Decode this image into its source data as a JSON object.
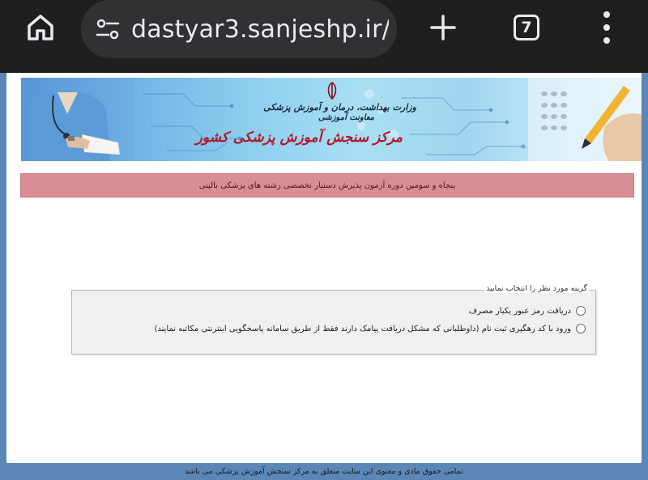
{
  "browser": {
    "url": "dastyar3.sanjeshp.ir/",
    "tab_count": "7",
    "icons": {
      "home": "home-icon",
      "site_settings": "tune-icon",
      "new_tab": "plus-icon",
      "tabs": "tab-switcher-icon",
      "menu": "more-vert-icon"
    }
  },
  "banner": {
    "line1": "وزارت بهداشت، درمان و آموزش پزشکی",
    "line2": "معاونت آموزشی",
    "line3": "مرکز سنجش آموزش پزشکی کشور"
  },
  "page": {
    "title": "پنجاه و سومین دوره آزمون پذیرش دستیار تخصصی رشته های پزشکی بالینی",
    "options_legend": "گزینه مورد نظر را انتخاب نمایید",
    "options": [
      {
        "label": "دریافت رمز عبور یکبار مصرف",
        "selected": false
      },
      {
        "label": "ورود با کد رهگیری ثبت نام (داوطلبانی که مشکل دریافت پیامک دارند فقط از طریق سامانه پاسخگویی اینترنتی مکاتبه نمایند)",
        "selected": false
      }
    ],
    "footer": "تمامی حقوق مادی و معنوی این سایت متعلق به مرکز سنجش آموزش پزشکی می باشد"
  },
  "colors": {
    "browser_bar": "#1f1f1f",
    "url_pill": "#2f3133",
    "outer_bg": "#5b86b5",
    "title_bar": "#d98d95",
    "fieldset_bg": "#f0f0f0"
  }
}
